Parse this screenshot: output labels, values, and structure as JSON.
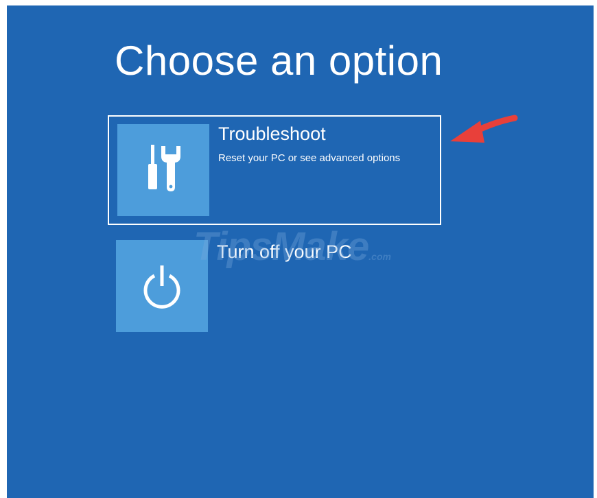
{
  "page": {
    "title": "Choose an option"
  },
  "options": [
    {
      "title": "Troubleshoot",
      "description": "Reset your PC or see advanced options",
      "icon": "tools-icon",
      "selected": true
    },
    {
      "title": "Turn off your PC",
      "description": "",
      "icon": "power-icon",
      "selected": false
    }
  ],
  "watermark": {
    "brand": "TipsMake",
    "suffix": ".com"
  },
  "colors": {
    "background": "#1f66b3",
    "tile": "#4d9ddb",
    "text": "#ffffff",
    "arrow": "#e8403a"
  }
}
